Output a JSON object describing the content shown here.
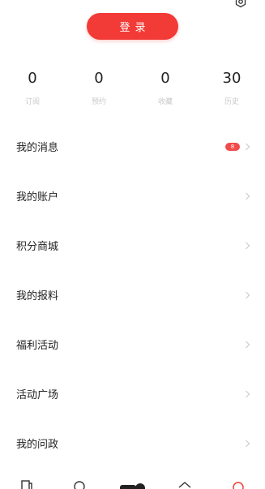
{
  "header": {
    "settings_icon": "settings-gear-icon"
  },
  "login": {
    "label": "登录"
  },
  "stats": [
    {
      "value": "0",
      "label": "订阅"
    },
    {
      "value": "0",
      "label": "预约"
    },
    {
      "value": "0",
      "label": "收藏"
    },
    {
      "value": "30",
      "label": "历史"
    }
  ],
  "menu": [
    {
      "label": "我的消息",
      "badge": "8"
    },
    {
      "label": "我的账户"
    },
    {
      "label": "积分商城"
    },
    {
      "label": "我的报料"
    },
    {
      "label": "福利活动"
    },
    {
      "label": "活动广场"
    },
    {
      "label": "我的问政"
    }
  ],
  "tabbar": {
    "icons": [
      "news-icon",
      "search-icon",
      "video-icon",
      "home-icon",
      "profile-icon"
    ],
    "active_color": "#f23a36"
  },
  "colors": {
    "accent": "#f23a36",
    "badge": "#f24b4b",
    "label_gray": "#c9c9c9",
    "chevron": "#cccccc"
  }
}
